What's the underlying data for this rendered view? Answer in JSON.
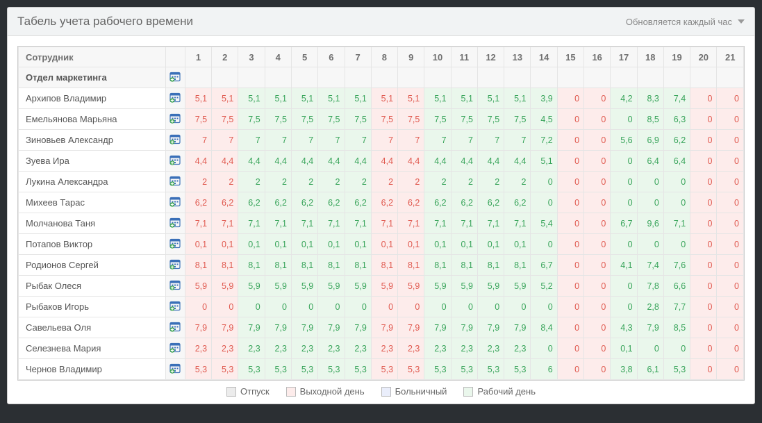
{
  "header": {
    "title": "Табель учета рабочего времени",
    "subtitle": "Обновляется каждый час"
  },
  "table": {
    "employee_header": "Сотрудник",
    "department": "Отдел маркетинга",
    "days": [
      1,
      2,
      3,
      4,
      5,
      6,
      7,
      8,
      9,
      10,
      11,
      12,
      13,
      14,
      15,
      16,
      17,
      18,
      19,
      20,
      21
    ],
    "rows": [
      {
        "name": "Архипов Владимир",
        "vals": [
          "5,1",
          "5,1",
          "5,1",
          "5,1",
          "5,1",
          "5,1",
          "5,1",
          "5,1",
          "5,1",
          "5,1",
          "5,1",
          "5,1",
          "5,1",
          "3,9",
          "0",
          "0",
          "4,2",
          "8,3",
          "7,4",
          "0",
          "0"
        ]
      },
      {
        "name": "Емельянова Марьяна",
        "vals": [
          "7,5",
          "7,5",
          "7,5",
          "7,5",
          "7,5",
          "7,5",
          "7,5",
          "7,5",
          "7,5",
          "7,5",
          "7,5",
          "7,5",
          "7,5",
          "4,5",
          "0",
          "0",
          "0",
          "8,5",
          "6,3",
          "0",
          "0"
        ]
      },
      {
        "name": "Зиновьев Александр",
        "vals": [
          "7",
          "7",
          "7",
          "7",
          "7",
          "7",
          "7",
          "7",
          "7",
          "7",
          "7",
          "7",
          "7",
          "7,2",
          "0",
          "0",
          "5,6",
          "6,9",
          "6,2",
          "0",
          "0"
        ]
      },
      {
        "name": "Зуева Ира",
        "vals": [
          "4,4",
          "4,4",
          "4,4",
          "4,4",
          "4,4",
          "4,4",
          "4,4",
          "4,4",
          "4,4",
          "4,4",
          "4,4",
          "4,4",
          "4,4",
          "5,1",
          "0",
          "0",
          "0",
          "6,4",
          "6,4",
          "0",
          "0"
        ]
      },
      {
        "name": "Лукина Александра",
        "vals": [
          "2",
          "2",
          "2",
          "2",
          "2",
          "2",
          "2",
          "2",
          "2",
          "2",
          "2",
          "2",
          "2",
          "0",
          "0",
          "0",
          "0",
          "0",
          "0",
          "0",
          "0"
        ]
      },
      {
        "name": "Михеев Тарас",
        "vals": [
          "6,2",
          "6,2",
          "6,2",
          "6,2",
          "6,2",
          "6,2",
          "6,2",
          "6,2",
          "6,2",
          "6,2",
          "6,2",
          "6,2",
          "6,2",
          "0",
          "0",
          "0",
          "0",
          "0",
          "0",
          "0",
          "0"
        ]
      },
      {
        "name": "Молчанова Таня",
        "vals": [
          "7,1",
          "7,1",
          "7,1",
          "7,1",
          "7,1",
          "7,1",
          "7,1",
          "7,1",
          "7,1",
          "7,1",
          "7,1",
          "7,1",
          "7,1",
          "5,4",
          "0",
          "0",
          "6,7",
          "9,6",
          "7,1",
          "0",
          "0"
        ]
      },
      {
        "name": "Потапов Виктор",
        "vals": [
          "0,1",
          "0,1",
          "0,1",
          "0,1",
          "0,1",
          "0,1",
          "0,1",
          "0,1",
          "0,1",
          "0,1",
          "0,1",
          "0,1",
          "0,1",
          "0",
          "0",
          "0",
          "0",
          "0",
          "0",
          "0",
          "0"
        ]
      },
      {
        "name": "Родионов Сергей",
        "vals": [
          "8,1",
          "8,1",
          "8,1",
          "8,1",
          "8,1",
          "8,1",
          "8,1",
          "8,1",
          "8,1",
          "8,1",
          "8,1",
          "8,1",
          "8,1",
          "6,7",
          "0",
          "0",
          "4,1",
          "7,4",
          "7,6",
          "0",
          "0"
        ]
      },
      {
        "name": "Рыбак Олеся",
        "vals": [
          "5,9",
          "5,9",
          "5,9",
          "5,9",
          "5,9",
          "5,9",
          "5,9",
          "5,9",
          "5,9",
          "5,9",
          "5,9",
          "5,9",
          "5,9",
          "5,2",
          "0",
          "0",
          "0",
          "7,8",
          "6,6",
          "0",
          "0"
        ]
      },
      {
        "name": "Рыбаков Игорь",
        "vals": [
          "0",
          "0",
          "0",
          "0",
          "0",
          "0",
          "0",
          "0",
          "0",
          "0",
          "0",
          "0",
          "0",
          "0",
          "0",
          "0",
          "0",
          "2,8",
          "7,7",
          "0",
          "0"
        ]
      },
      {
        "name": "Савельева Оля",
        "vals": [
          "7,9",
          "7,9",
          "7,9",
          "7,9",
          "7,9",
          "7,9",
          "7,9",
          "7,9",
          "7,9",
          "7,9",
          "7,9",
          "7,9",
          "7,9",
          "8,4",
          "0",
          "0",
          "4,3",
          "7,9",
          "8,5",
          "0",
          "0"
        ]
      },
      {
        "name": "Селезнева Мария",
        "vals": [
          "2,3",
          "2,3",
          "2,3",
          "2,3",
          "2,3",
          "2,3",
          "2,3",
          "2,3",
          "2,3",
          "2,3",
          "2,3",
          "2,3",
          "2,3",
          "0",
          "0",
          "0",
          "0,1",
          "0",
          "0",
          "0",
          "0"
        ]
      },
      {
        "name": "Чернов Владимир",
        "vals": [
          "5,3",
          "5,3",
          "5,3",
          "5,3",
          "5,3",
          "5,3",
          "5,3",
          "5,3",
          "5,3",
          "5,3",
          "5,3",
          "5,3",
          "5,3",
          "6",
          "0",
          "0",
          "3,8",
          "6,1",
          "5,3",
          "0",
          "0"
        ]
      }
    ],
    "day_types": [
      "wkend",
      "wkend",
      "work",
      "work",
      "work",
      "work",
      "work",
      "wkend",
      "wkend",
      "work",
      "work",
      "work",
      "work",
      "work",
      "wkend",
      "wkend",
      "work",
      "work",
      "work",
      "wkend",
      "wkend"
    ]
  },
  "legend": {
    "holiday": "Отпуск",
    "weekend": "Выходной день",
    "sick": "Больничный",
    "workday": "Рабочий день"
  }
}
